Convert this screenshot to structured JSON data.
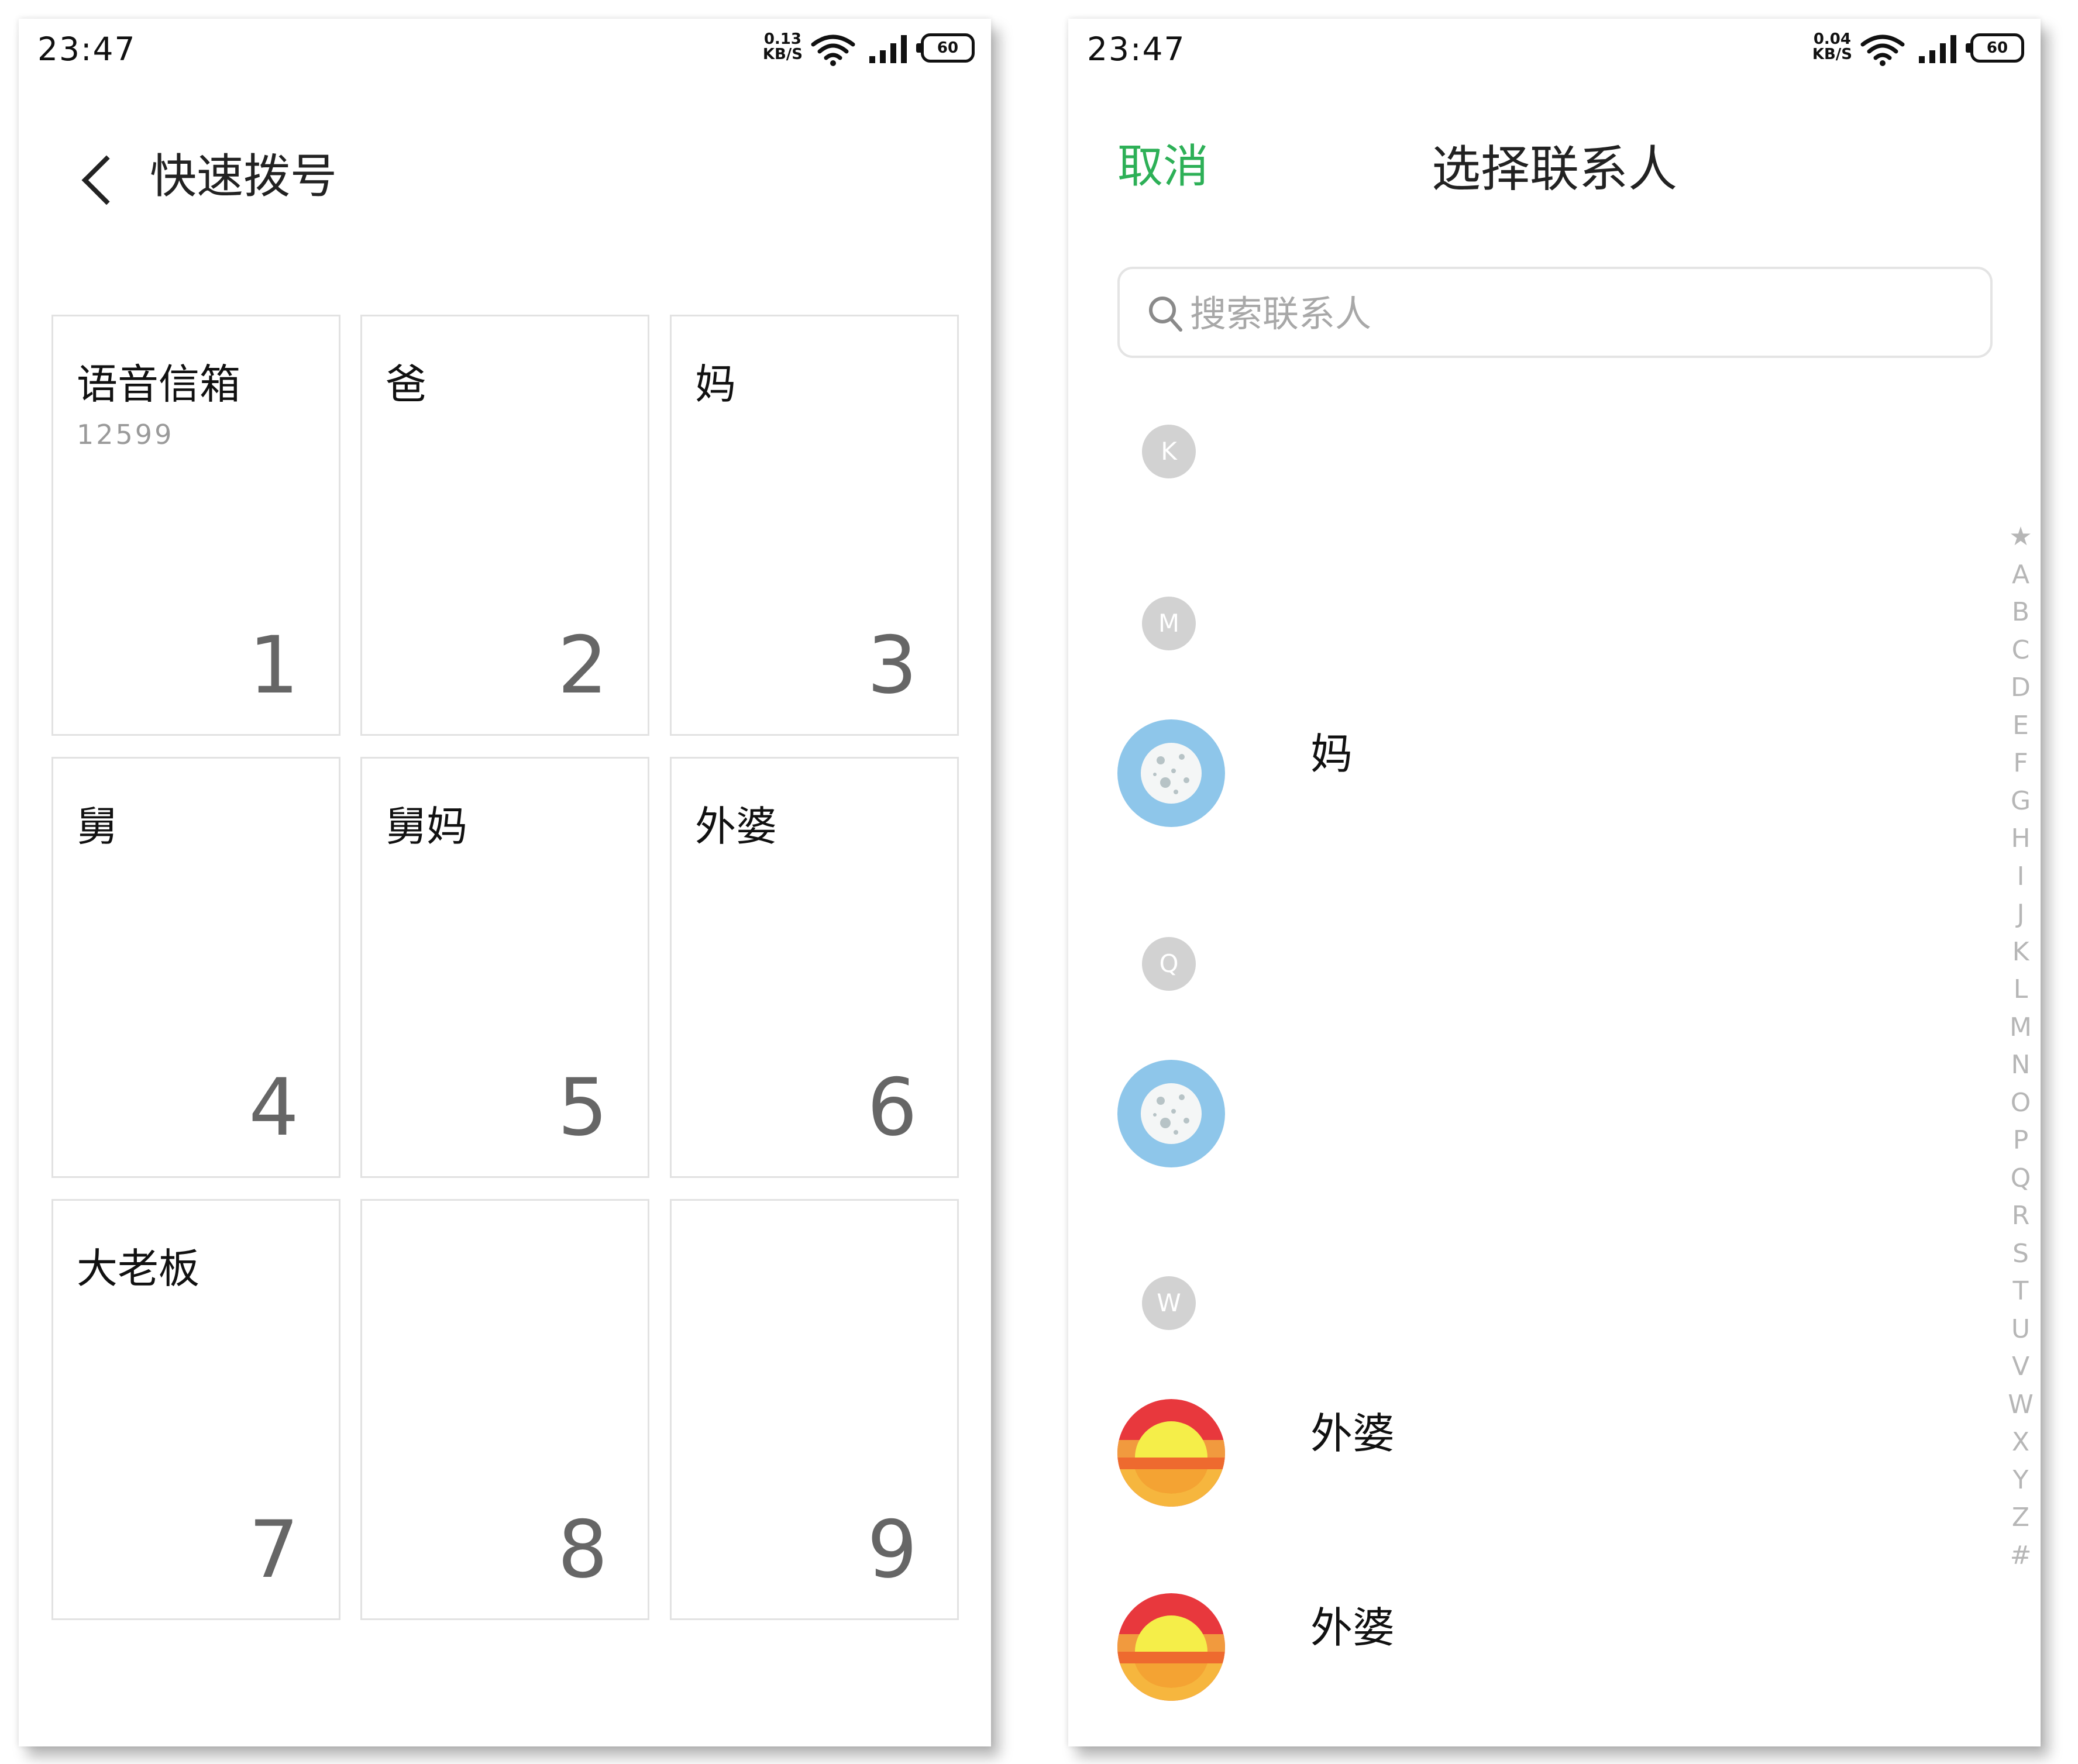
{
  "left_screen": {
    "status": {
      "time": "23:47",
      "speed_value": "0.13",
      "speed_unit": "KB/S",
      "battery": "60"
    },
    "title": "快速拨号",
    "cells": [
      {
        "name": "语音信箱",
        "sub": "12599",
        "num": "1"
      },
      {
        "name": "爸",
        "sub": "",
        "num": "2"
      },
      {
        "name": "妈",
        "sub": "",
        "num": "3"
      },
      {
        "name": "舅",
        "sub": "",
        "num": "4"
      },
      {
        "name": "舅妈",
        "sub": "",
        "num": "5"
      },
      {
        "name": "外婆",
        "sub": "",
        "num": "6"
      },
      {
        "name": "大老板",
        "sub": "",
        "num": "7"
      },
      {
        "name": "",
        "sub": "",
        "num": "8"
      },
      {
        "name": "",
        "sub": "",
        "num": "9"
      }
    ]
  },
  "right_screen": {
    "status": {
      "time": "23:47",
      "speed_value": "0.04",
      "speed_unit": "KB/S",
      "battery": "60"
    },
    "cancel": "取消",
    "title": "选择联系人",
    "search_placeholder": "搜索联系人",
    "sections": [
      "K",
      "M",
      "Q",
      "W"
    ],
    "contacts": [
      {
        "name": "妈",
        "avatar": "blue-moon-avatar"
      },
      {
        "name": "",
        "avatar": "blue-moon-avatar"
      },
      {
        "name": "外婆",
        "avatar": "sunset-avatar"
      },
      {
        "name": "外婆",
        "avatar": "sunset-avatar"
      }
    ],
    "index": [
      "★",
      "A",
      "B",
      "C",
      "D",
      "E",
      "F",
      "G",
      "H",
      "I",
      "J",
      "K",
      "L",
      "M",
      "N",
      "O",
      "P",
      "Q",
      "R",
      "S",
      "T",
      "U",
      "V",
      "W",
      "X",
      "Y",
      "Z",
      "#"
    ]
  },
  "colors": {
    "accent_green": "#2db057",
    "moon_blue": "#8ec6ea",
    "section_gray": "#d2d2d2"
  }
}
